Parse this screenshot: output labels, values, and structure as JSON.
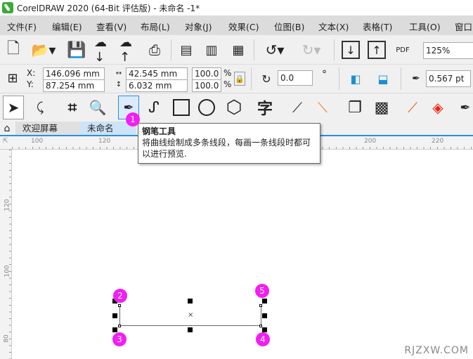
{
  "window": {
    "title": "CorelDRAW 2020 (64-Bit 评估版) - 未命名 -1*"
  },
  "menu": [
    "文件(F)",
    "编辑(E)",
    "查看(V)",
    "布局(L)",
    "对象(J)",
    "效果(C)",
    "位图(B)",
    "文本(X)",
    "表格(T)",
    "工具(O)",
    "窗口"
  ],
  "toolbar": {
    "zoom": "125%",
    "pdf_label": "PDF"
  },
  "propbar": {
    "x_label": "X:",
    "y_label": "Y:",
    "x": "146.096 mm",
    "y": "87.254 mm",
    "width": "42.545 mm",
    "height": "6.032 mm",
    "scale_w": "100.0",
    "scale_h": "100.0",
    "percent": "%",
    "rotation": "0.0",
    "degree": "°",
    "outline": "0.567 pt"
  },
  "tabs": [
    {
      "label": "欢迎屏幕"
    },
    {
      "label": "未命名 -1*"
    }
  ],
  "tooltip": {
    "title": "钢笔工具",
    "body": "将曲线绘制成多条线段，每画一条线段时都可以进行预览."
  },
  "hruler": [
    "100",
    "120",
    "200",
    "220"
  ],
  "vruler": [
    "120",
    "100",
    "80"
  ],
  "badges": [
    "1",
    "2",
    "3",
    "4",
    "5"
  ],
  "watermark": "RJZXW.COM",
  "colors": {
    "accent": "#2b8fe0",
    "badge": "#f21ef2"
  }
}
